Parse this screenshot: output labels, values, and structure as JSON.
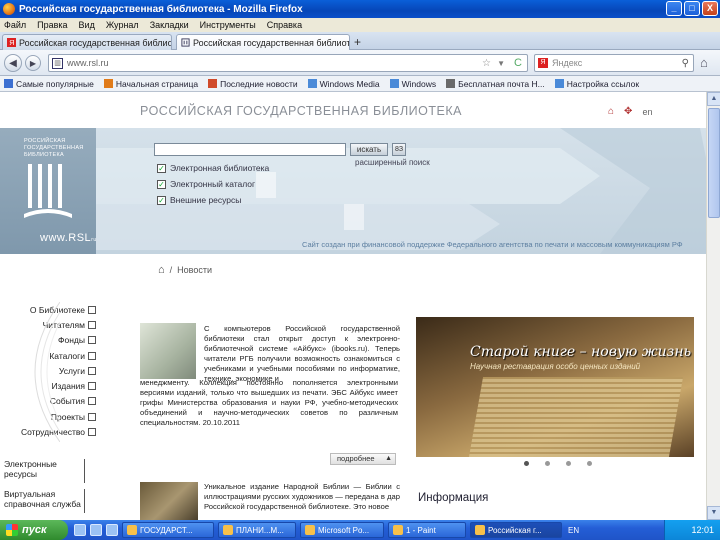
{
  "window": {
    "title": "Российская государственная библиотека - Mozilla Firefox",
    "minimize": "_",
    "maximize": "□",
    "close": "X"
  },
  "menu": [
    "Файл",
    "Правка",
    "Вид",
    "Журнал",
    "Закладки",
    "Инструменты",
    "Справка"
  ],
  "tabs": [
    {
      "label": "Российская государственная библиот...",
      "close": "×",
      "active": false
    },
    {
      "label": "Российская государственная библиот...",
      "close": "×",
      "active": true
    }
  ],
  "new_tab": "+",
  "nav": {
    "back": "◀",
    "forward": "▶",
    "url": "www.rsl.ru",
    "star": "☆",
    "reload": "C",
    "search_placeholder": "Яндекс",
    "search_icon_letter": "Я"
  },
  "bookmarks": [
    {
      "label": "Самые популярные",
      "icon_color": "#3b6fd1"
    },
    {
      "label": "Начальная страница",
      "icon_color": "#e07b1a"
    },
    {
      "label": "Последние новости",
      "icon_color": "#d04a2a"
    },
    {
      "label": "Windows Media",
      "icon_color": "#4a8ad8"
    },
    {
      "label": "Windows",
      "icon_color": "#4a8ad8"
    },
    {
      "label": "Бесплатная почта H...",
      "icon_color": "#6a6a6a"
    },
    {
      "label": "Настройка ссылок",
      "icon_color": "#4a8ad8"
    }
  ],
  "site": {
    "title": "РОССИЙСКАЯ ГОСУДАРСТВЕННАЯ БИБЛИОТЕКА",
    "lang": "en",
    "logo_text": [
      "РОССИЙСКАЯ",
      "ГОСУДАРСТВЕННАЯ",
      "БИБЛИОТЕКА"
    ],
    "rsl": "www.RSL",
    "rsl_suffix": "ru",
    "search_button": "искать",
    "ext_button": "8З",
    "search_hint": "расширенный поиск",
    "checkboxes": [
      {
        "label": "Электронная библиотека",
        "checked": true
      },
      {
        "label": "Электронный каталог",
        "checked": true
      },
      {
        "label": "Внешние ресурсы",
        "checked": true
      }
    ],
    "banner_footer": "Сайт создан при финансовой поддержке Федерального агентства по печати и массовым коммуникациям РФ",
    "breadcrumb": {
      "home": "⌂",
      "sep": "/",
      "current": "Новости"
    }
  },
  "left_nav": [
    "О Библиотеке",
    "Читателям",
    "Фонды",
    "Каталоги",
    "Услуги",
    "Издания",
    "События",
    "Проекты",
    "Сотрудничество"
  ],
  "side_boxes": [
    {
      "lines": [
        "Электронные",
        "ресурсы"
      ]
    },
    {
      "lines": [
        "Виртуальная",
        "справочная служба"
      ]
    }
  ],
  "news": {
    "item1_text": "С компьютеров Российской государственной библиотеки стал открыт доступ к электронно-библиотечной системе «Айбукс» (ibooks.ru). Теперь читатели РГБ получили возможность ознакомиться с учебниками и учебными пособиями по информатике, технике, экономике и",
    "item1_text_cont": "менеджменту. Коллекция постоянно пополняется электронными версиями изданий, только что вышедших из печати. ЭБС Айбукс имеет грифы Министерства образования и науки РФ, учебно-методических объединений и научно-методических советов по различным специальностям. 20.10.2011",
    "more": "подробнее",
    "item2_text": "Уникальное издание Народной Библии — Библии с иллюстрациями русских художников — передана в дар Российской государственной библиотеке. Это новое"
  },
  "slider": {
    "title": "Старой книге – новую жизнь",
    "subtitle": "Научная реставрация особо ценных изданий",
    "dots": 4,
    "active_dot": 0
  },
  "info_heading": "Информация",
  "taskbar": {
    "start": "пуск",
    "tasks": [
      {
        "label": "ГОСУДАРСТ...",
        "active": false
      },
      {
        "label": "ПЛАНИ...М...",
        "active": false
      },
      {
        "label": "Microsoft Po...",
        "active": false
      },
      {
        "label": "1 - Paint",
        "active": false
      },
      {
        "label": "Российская г...",
        "active": true
      }
    ],
    "lang": "EN",
    "clock": "12:01"
  }
}
